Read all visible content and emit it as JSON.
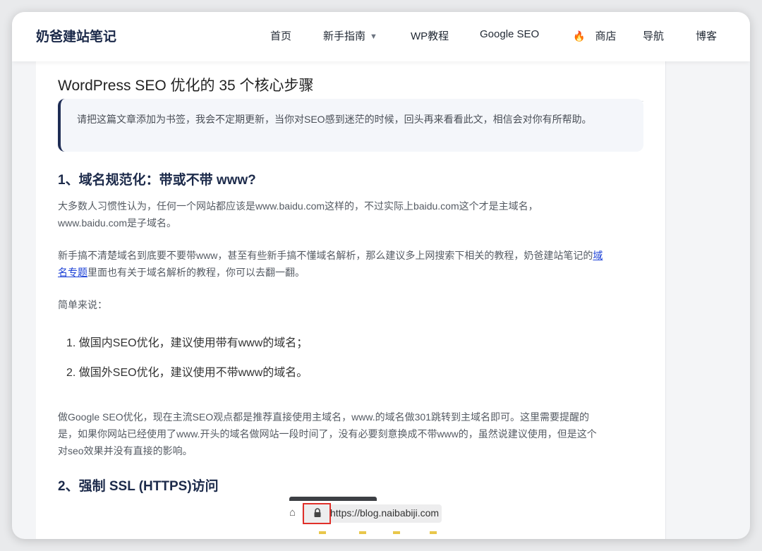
{
  "header": {
    "brand": "奶爸建站笔记",
    "nav": [
      {
        "label": "首页"
      },
      {
        "label": "新手指南",
        "has_dropdown": true
      },
      {
        "label": "WP教程"
      },
      {
        "label": "Google SEO"
      },
      {
        "label": "商店",
        "icon": "fire-icon"
      },
      {
        "label": "导航"
      },
      {
        "label": "博客"
      }
    ]
  },
  "article": {
    "title": "WordPress SEO 优化的 35 个核心步骤",
    "notice": "请把这篇文章添加为书签，我会不定期更新，当你对SEO感到迷茫的时候，回头再来看看此文，相信会对你有所帮助。",
    "section1": {
      "heading": "1、域名规范化：带或不带 www?",
      "para1_line1": "大多数人习惯性认为，任何一个网站都应该是www.baidu.com这样的，不过实际上baidu.com这个才是主域名，",
      "para1_line2": "www.baidu.com是子域名。",
      "para2_before_link": "新手搞不清楚域名到底要不要带www，甚至有些新手搞不懂域名解析，那么建议多上网搜索下相关的教程，奶爸建站笔记的",
      "para2_link_1": "域",
      "para2_link_2": "名专题",
      "para2_after_link": "里面也有关于域名解析的教程，你可以去翻一翻。",
      "summary_label": "简单来说：",
      "list": [
        "1. 做国内SEO优化，建议使用带有www的域名；",
        "2. 做国外SEO优化，建议使用不带www的域名。"
      ],
      "para3_line1": "做Google SEO优化，现在主流SEO观点都是推荐直接使用主域名，www.的域名做301跳转到主域名即可。这里需要提醒的",
      "para3_line2": "是，如果你网站已经使用了www.开头的域名做网站一段时间了，没有必要刻意换成不带www的，虽然说建议使用，但是这个",
      "para3_line3": "对seo效果并没有直接的影响。"
    },
    "section2": {
      "heading": "2、强制 SSL (HTTPS)访问",
      "screenshot_url": "https://blog.naibabiji.com"
    }
  },
  "colors": {
    "brand": "#1c2a4a",
    "link": "#1a3fd6",
    "notice_border": "#1f2d55",
    "highlight_box": "#e0302a",
    "fire": "#f06b1c"
  }
}
